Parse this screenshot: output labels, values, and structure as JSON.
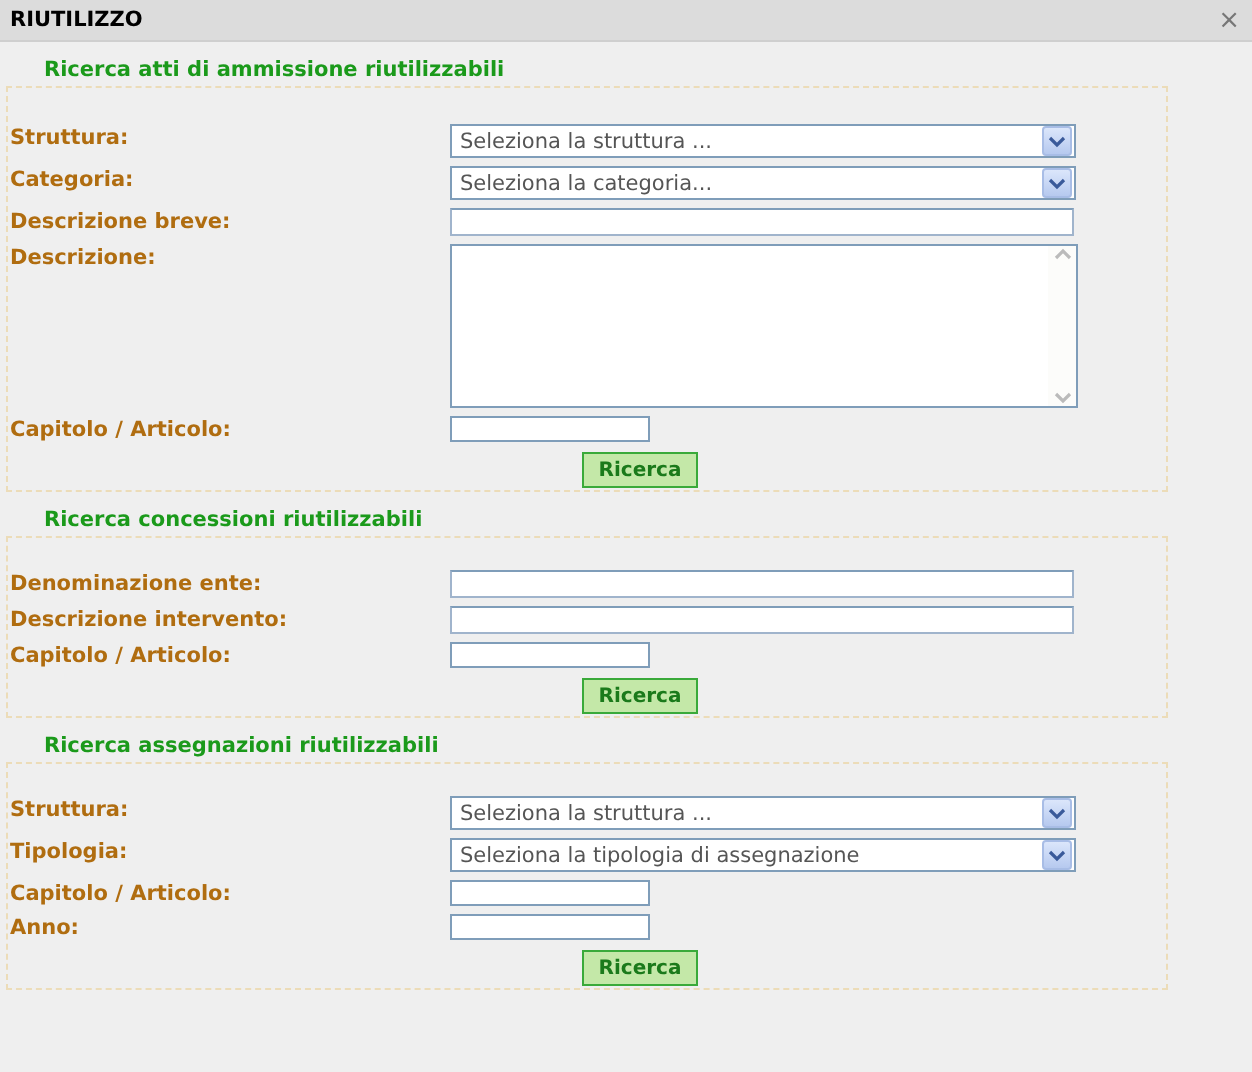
{
  "window": {
    "title": "RIUTILIZZO",
    "close": "×"
  },
  "sections": [
    {
      "title": "Ricerca atti di ammissione riutilizzabili",
      "fields": [
        {
          "label": "Struttura:",
          "kind": "select",
          "placeholder": "Seleziona la struttura ..."
        },
        {
          "label": "Categoria:",
          "kind": "select",
          "placeholder": "Seleziona la categoria..."
        },
        {
          "label": "Descrizione breve:",
          "kind": "text"
        },
        {
          "label": "Descrizione:",
          "kind": "textarea"
        },
        {
          "label": "Capitolo / Articolo:",
          "kind": "short"
        }
      ],
      "button": "Ricerca"
    },
    {
      "title": "Ricerca concessioni riutilizzabili",
      "fields": [
        {
          "label": "Denominazione ente:",
          "kind": "text"
        },
        {
          "label": "Descrizione intervento:",
          "kind": "text"
        },
        {
          "label": "Capitolo / Articolo:",
          "kind": "short"
        }
      ],
      "button": "Ricerca"
    },
    {
      "title": "Ricerca assegnazioni riutilizzabili",
      "fields": [
        {
          "label": "Struttura:",
          "kind": "select",
          "placeholder": "Seleziona la struttura ..."
        },
        {
          "label": "Tipologia:",
          "kind": "select",
          "placeholder": "Seleziona la tipologia di assegnazione"
        },
        {
          "label": "Capitolo / Articolo:",
          "kind": "short"
        },
        {
          "label": "Anno:",
          "kind": "short"
        }
      ],
      "button": "Ricerca"
    }
  ]
}
